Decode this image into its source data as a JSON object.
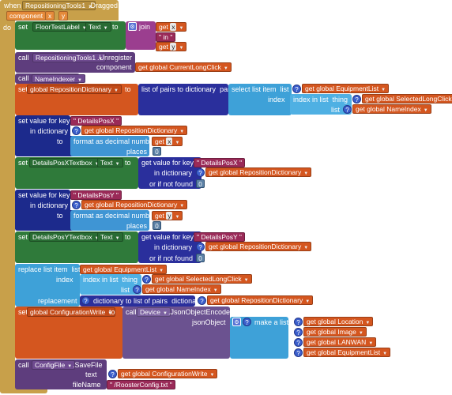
{
  "event": {
    "when": "when",
    "component": "RepositioningTools1",
    "event": ".Dragged",
    "params_label": "component",
    "param_x": "x",
    "param_y": "y",
    "do": "do"
  },
  "set1": {
    "set": "set",
    "component": "FloorTestLabel",
    "prop": "Text",
    "to": "to",
    "join": "join",
    "get_x": "get",
    "x": "x",
    "text_in": "in",
    "get_y": "get",
    "y": "y"
  },
  "unregister": {
    "call": "call",
    "component": "RepositioningTools1",
    "method": ".Unregister",
    "param": "component",
    "get": "get",
    "global": "global CurrentLongClick"
  },
  "nameindexer": {
    "call": "call",
    "component": "NameIndexer"
  },
  "setrep": {
    "set": "set",
    "global": "global RepositionDictionary",
    "to": "to",
    "list_to_dict": "list of pairs to dictionary",
    "pairs": "pairs",
    "select": "select list item",
    "list": "list",
    "get1": "get",
    "g1": "global EquipmentList",
    "index": "index",
    "index_in_list": "index in list",
    "thing": "thing",
    "get2": "get",
    "g2": "global SelectedLongClick",
    "list2": "list",
    "get3": "get",
    "g3": "global NameIndex"
  },
  "svk1": {
    "set_value": "set value for key",
    "key": "DetailsPosX",
    "in_dict": "in dictionary",
    "get": "get",
    "dict": "global RepositionDictionary",
    "to": "to",
    "format": "format as decimal number",
    "get_x": "get",
    "x": "x",
    "places": "places",
    "places_val": "0"
  },
  "set2": {
    "set": "set",
    "component": "DetailsPosXTextbox",
    "prop": "Text",
    "to": "to",
    "get_value": "get value for key",
    "key": "DetailsPosX",
    "in_dict": "in dictionary",
    "get": "get",
    "dict": "global RepositionDictionary",
    "notfound": "or if not found",
    "nf_val": "0"
  },
  "svk2": {
    "set_value": "set value for key",
    "key": "DetailsPosY",
    "in_dict": "in dictionary",
    "get": "get",
    "dict": "global RepositionDictionary",
    "to": "to",
    "format": "format as decimal number",
    "get_y": "get",
    "y": "y",
    "places": "places",
    "places_val": "0"
  },
  "set3": {
    "set": "set",
    "component": "DetailsPosYTextbox",
    "prop": "Text",
    "to": "to",
    "get_value": "get value for key",
    "key": "DetailsPosY",
    "in_dict": "in dictionary",
    "get": "get",
    "dict": "global RepositionDictionary",
    "notfound": "or if not found",
    "nf_val": "0"
  },
  "replace": {
    "replace": "replace list item",
    "list": "list",
    "get1": "get",
    "g1": "global EquipmentList",
    "index": "index",
    "index_in_list": "index in list",
    "thing": "thing",
    "get2": "get",
    "g2": "global SelectedLongClick",
    "list2": "list",
    "get3": "get",
    "g3": "global NameIndex",
    "replacement": "replacement",
    "dict_to_list": "dictionary to list of pairs",
    "dictionary": "dictionary",
    "get4": "get",
    "g4": "global RepositionDictionary"
  },
  "setconf": {
    "set": "set",
    "global": "global ConfigurationWrite",
    "to": "to",
    "call": "call",
    "component": "Device",
    "method": ".JsonObjectEncode",
    "jsonObject": "jsonObject",
    "make_list": "make a list",
    "get1": "get",
    "g1": "global Location",
    "get2": "get",
    "g2": "global Image",
    "get3": "get",
    "g3": "global LANWAN",
    "get4": "get",
    "g4": "global EquipmentList"
  },
  "savefile": {
    "call": "call",
    "component": "ConfigFile",
    "method": ".SaveFile",
    "text": "text",
    "get": "get",
    "g": "global ConfigurationWrite",
    "fileName": "fileName",
    "filename_val": "/RoosterConfig.txt"
  }
}
